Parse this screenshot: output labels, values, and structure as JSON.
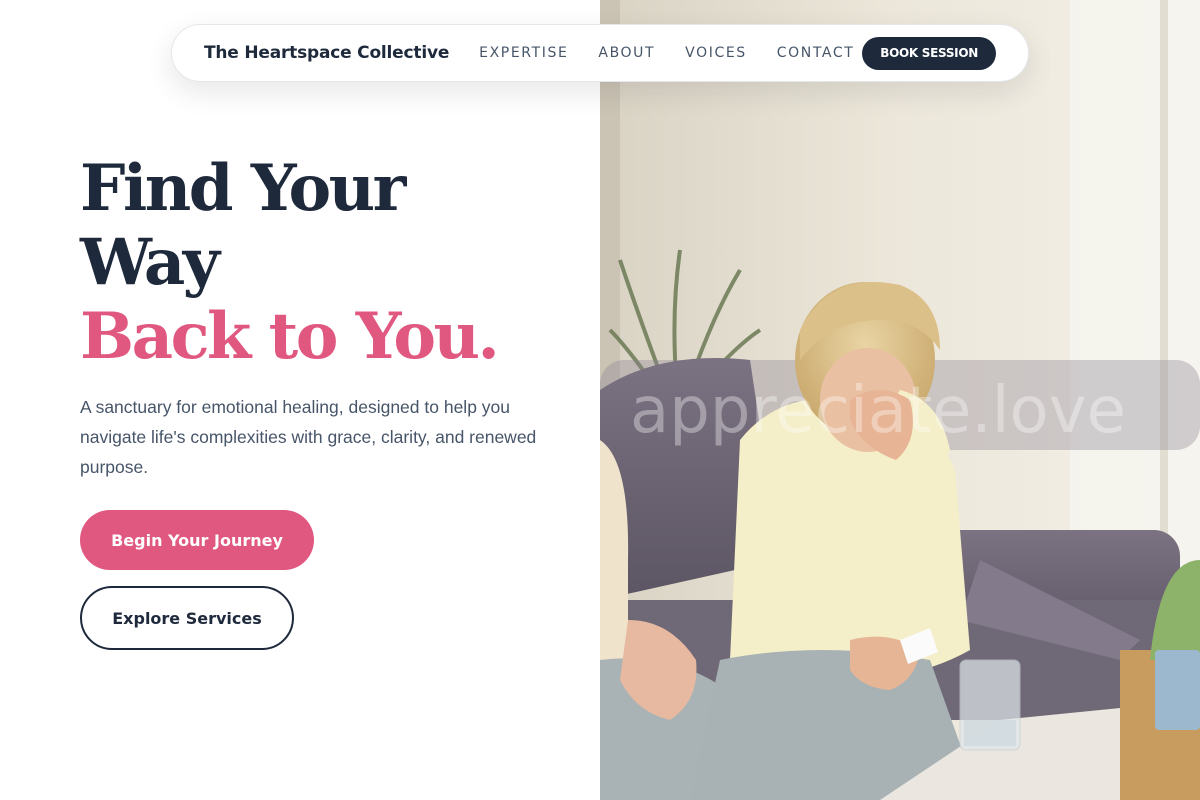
{
  "nav": {
    "brand": "The Heartspace Collective",
    "links": [
      "EXPERTISE",
      "ABOUT",
      "VOICES",
      "CONTACT"
    ],
    "cta": "BOOK SESSION"
  },
  "hero": {
    "headline_line1": "Find Your",
    "headline_line2": "Way",
    "headline_accent": "Back to You.",
    "subtitle": "A sanctuary for emotional healing, designed to help you navigate life's complexities with grace, clarity, and renewed purpose.",
    "primary_cta": "Begin Your Journey",
    "secondary_cta": "Explore Services"
  },
  "photo": {
    "watermark": "appreciate.love",
    "alt": "A woman in a therapy session covering her face, holding a tissue, seated on a grey sofa"
  },
  "colors": {
    "accent": "#e05780",
    "navy": "#1e293b",
    "body_text": "#475569"
  }
}
